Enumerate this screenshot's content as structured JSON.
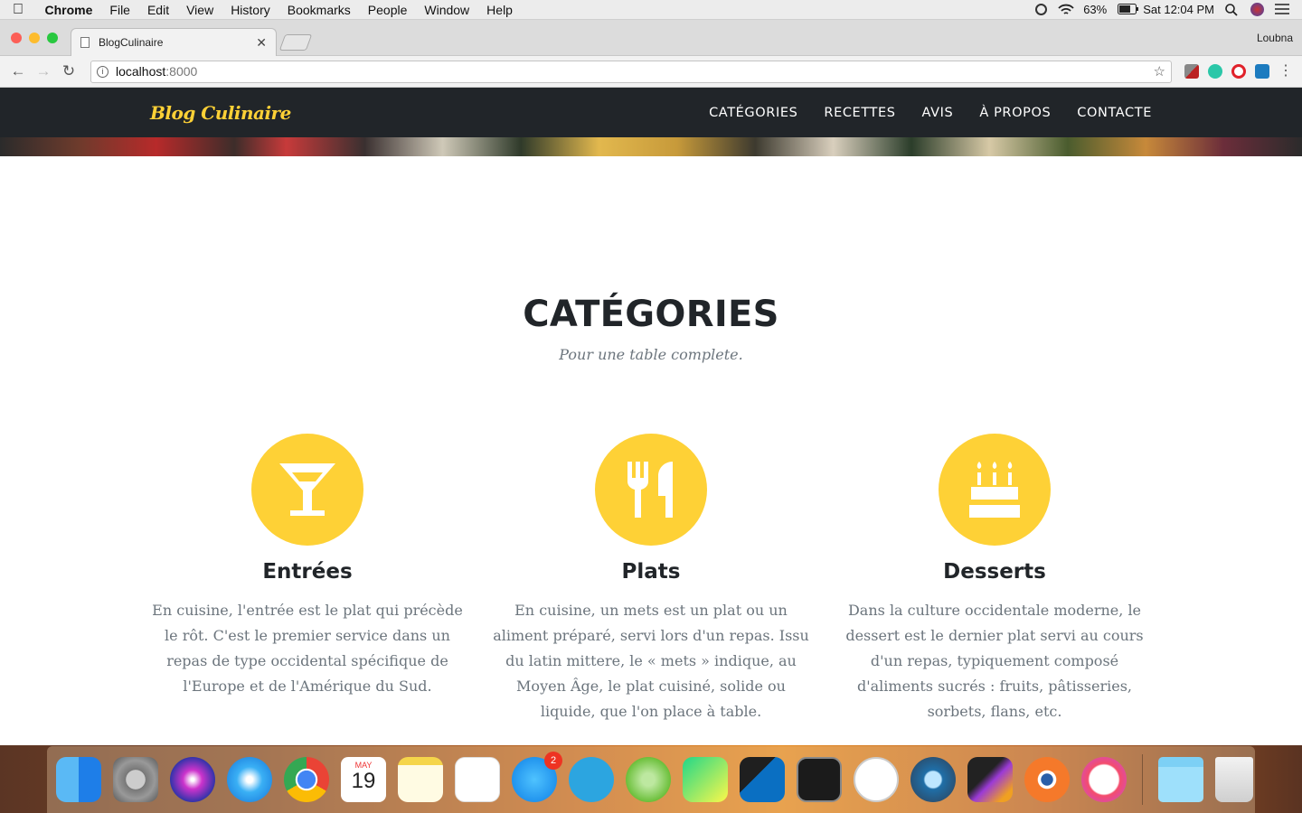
{
  "menubar": {
    "app": "Chrome",
    "items": [
      "File",
      "Edit",
      "View",
      "History",
      "Bookmarks",
      "People",
      "Window",
      "Help"
    ],
    "battery": "63%",
    "clock": "Sat 12:04 PM"
  },
  "browser": {
    "tab_title": "BlogCulinaire",
    "profile": "Loubna",
    "url_host": "localhost",
    "url_port": ":8000"
  },
  "site": {
    "brand": "Blog Culinaire",
    "nav": [
      "CATÉGORIES",
      "RECETTES",
      "AVIS",
      "À PROPOS",
      "CONTACTE"
    ],
    "section_heading": "CATÉGORIES",
    "section_subheading": "Pour une table complete.",
    "accent_color": "#fed136",
    "cards": [
      {
        "title": "Entrées",
        "icon": "cocktail-icon",
        "text": "En cuisine, l'entrée est le plat qui précède le rôt. C'est le premier service dans un repas de type occidental spécifique de l'Europe et de l'Amérique du Sud."
      },
      {
        "title": "Plats",
        "icon": "utensils-icon",
        "text": "En cuisine, un mets est un plat ou un aliment préparé, servi lors d'un repas. Issu du latin mittere, le « mets » indique, au Moyen Âge, le plat cuisiné, solide ou liquide, que l'on place à table."
      },
      {
        "title": "Desserts",
        "icon": "birthday-cake-icon",
        "text": "Dans la culture occidentale moderne, le dessert est le dernier plat servi au cours d'un repas, typiquement composé d'aliments sucrés : fruits, pâtisseries, sorbets, flans, etc."
      }
    ]
  },
  "dock": {
    "calendar_month": "MAY",
    "calendar_day": "19",
    "appstore_badge": "2",
    "icons": [
      "finder-icon",
      "system-preferences-icon",
      "siri-icon",
      "safari-icon",
      "chrome-icon",
      "calendar-icon",
      "notes-icon",
      "reminders-icon",
      "app-store-icon",
      "telegram-icon",
      "android-studio-icon",
      "pycharm-icon",
      "vscode-icon",
      "terminal-icon",
      "clock-icon",
      "quicktime-icon",
      "final-cut-icon",
      "blender-icon",
      "itunes-icon",
      "folder-icon",
      "trash-icon"
    ]
  }
}
